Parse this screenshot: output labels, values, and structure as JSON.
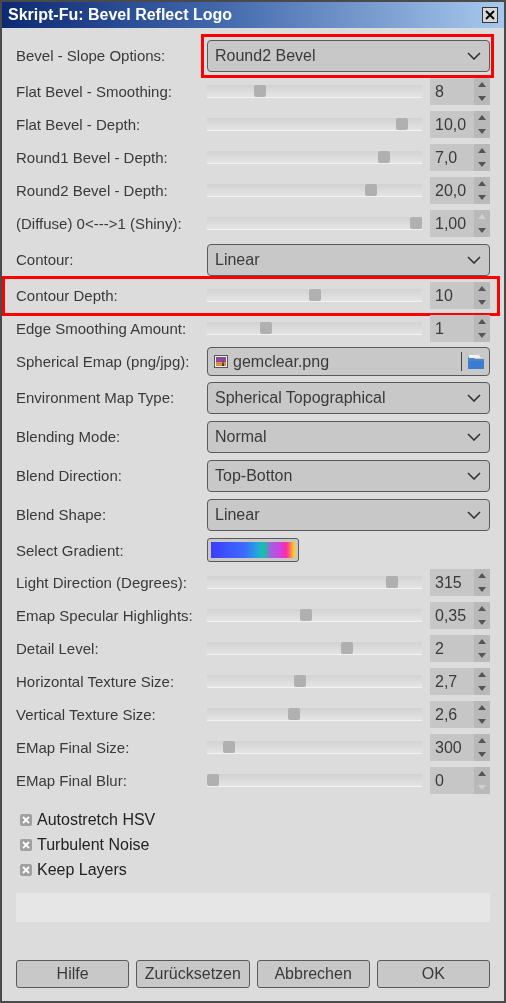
{
  "window": {
    "title": "Skript-Fu: Bevel Reflect Logo"
  },
  "rows": [
    {
      "kind": "combo",
      "label": "Bevel - Slope Options:",
      "value": "Round2 Bevel",
      "field_highlighted": true,
      "row_highlighted": false
    },
    {
      "kind": "slider",
      "label": "Flat Bevel - Smoothing:",
      "level": 0.23,
      "value": "8",
      "up_disabled": false,
      "down_disabled": false,
      "field_highlighted": false,
      "row_highlighted": false
    },
    {
      "kind": "slider",
      "label": "Flat Bevel - Depth:",
      "level": 0.93,
      "value": "10,0",
      "up_disabled": false,
      "down_disabled": false,
      "field_highlighted": false,
      "row_highlighted": false
    },
    {
      "kind": "slider",
      "label": "Round1 Bevel - Depth:",
      "level": 0.84,
      "value": "7,0",
      "up_disabled": false,
      "down_disabled": false,
      "field_highlighted": false,
      "row_highlighted": false
    },
    {
      "kind": "slider",
      "label": "Round2 Bevel - Depth:",
      "level": 0.78,
      "value": "20,0",
      "up_disabled": false,
      "down_disabled": false,
      "field_highlighted": false,
      "row_highlighted": false
    },
    {
      "kind": "slider",
      "label": "(Diffuse) 0<--->1 (Shiny):",
      "level": 1,
      "value": "1,00",
      "up_disabled": true,
      "down_disabled": false,
      "field_highlighted": false,
      "row_highlighted": false
    },
    {
      "kind": "combo",
      "label": "Contour:",
      "value": "Linear",
      "field_highlighted": false,
      "row_highlighted": false
    },
    {
      "kind": "slider",
      "label": "Contour Depth:",
      "level": 0.5,
      "value": "10",
      "up_disabled": false,
      "down_disabled": false,
      "field_highlighted": false,
      "row_highlighted": true
    },
    {
      "kind": "slider",
      "label": "Edge Smoothing Amount:",
      "level": 0.26,
      "value": "1",
      "up_disabled": false,
      "down_disabled": false,
      "field_highlighted": false,
      "row_highlighted": false
    },
    {
      "kind": "file",
      "label": "Spherical Emap (png/jpg):",
      "value": "gemclear.png",
      "field_highlighted": false,
      "row_highlighted": false
    },
    {
      "kind": "combo",
      "label": "Environment Map Type:",
      "value": "Spherical Topographical",
      "field_highlighted": false,
      "row_highlighted": false
    },
    {
      "kind": "combo",
      "label": "Blending Mode:",
      "value": "Normal",
      "field_highlighted": false,
      "row_highlighted": false
    },
    {
      "kind": "combo",
      "label": "Blend Direction:",
      "value": "Top-Botton",
      "field_highlighted": false,
      "row_highlighted": false
    },
    {
      "kind": "combo",
      "label": "Blend Shape:",
      "value": "Linear",
      "field_highlighted": false,
      "row_highlighted": false
    },
    {
      "kind": "gradient",
      "label": "Select Gradient:",
      "field_highlighted": false,
      "row_highlighted": false
    },
    {
      "kind": "slider",
      "label": "Light Direction (Degrees):",
      "level": 0.88,
      "value": "315",
      "up_disabled": false,
      "down_disabled": false,
      "field_highlighted": false,
      "row_highlighted": false
    },
    {
      "kind": "slider",
      "label": "Emap Specular Highlights:",
      "level": 0.46,
      "value": "0,35",
      "up_disabled": false,
      "down_disabled": false,
      "field_highlighted": false,
      "row_highlighted": false
    },
    {
      "kind": "slider",
      "label": "Detail Level:",
      "level": 0.66,
      "value": "2",
      "up_disabled": false,
      "down_disabled": false,
      "field_highlighted": false,
      "row_highlighted": false
    },
    {
      "kind": "slider",
      "label": "Horizontal Texture Size:",
      "level": 0.43,
      "value": "2,7",
      "up_disabled": false,
      "down_disabled": false,
      "field_highlighted": false,
      "row_highlighted": false
    },
    {
      "kind": "slider",
      "label": "Vertical Texture Size:",
      "level": 0.4,
      "value": "2,6",
      "up_disabled": false,
      "down_disabled": false,
      "field_highlighted": false,
      "row_highlighted": false
    },
    {
      "kind": "slider",
      "label": "EMap Final Size:",
      "level": 0.08,
      "value": "300",
      "up_disabled": false,
      "down_disabled": false,
      "field_highlighted": false,
      "row_highlighted": false
    },
    {
      "kind": "slider",
      "label": "EMap Final Blur:",
      "level": 0,
      "value": "0",
      "up_disabled": false,
      "down_disabled": true,
      "field_highlighted": false,
      "row_highlighted": false
    }
  ],
  "checkboxes": [
    {
      "label": "Autostretch HSV",
      "checked": true
    },
    {
      "label": "Turbulent Noise",
      "checked": true
    },
    {
      "label": "Keep Layers",
      "checked": true
    }
  ],
  "buttons": [
    "Hilfe",
    "Zurücksetzen",
    "Abbrechen",
    "OK"
  ]
}
